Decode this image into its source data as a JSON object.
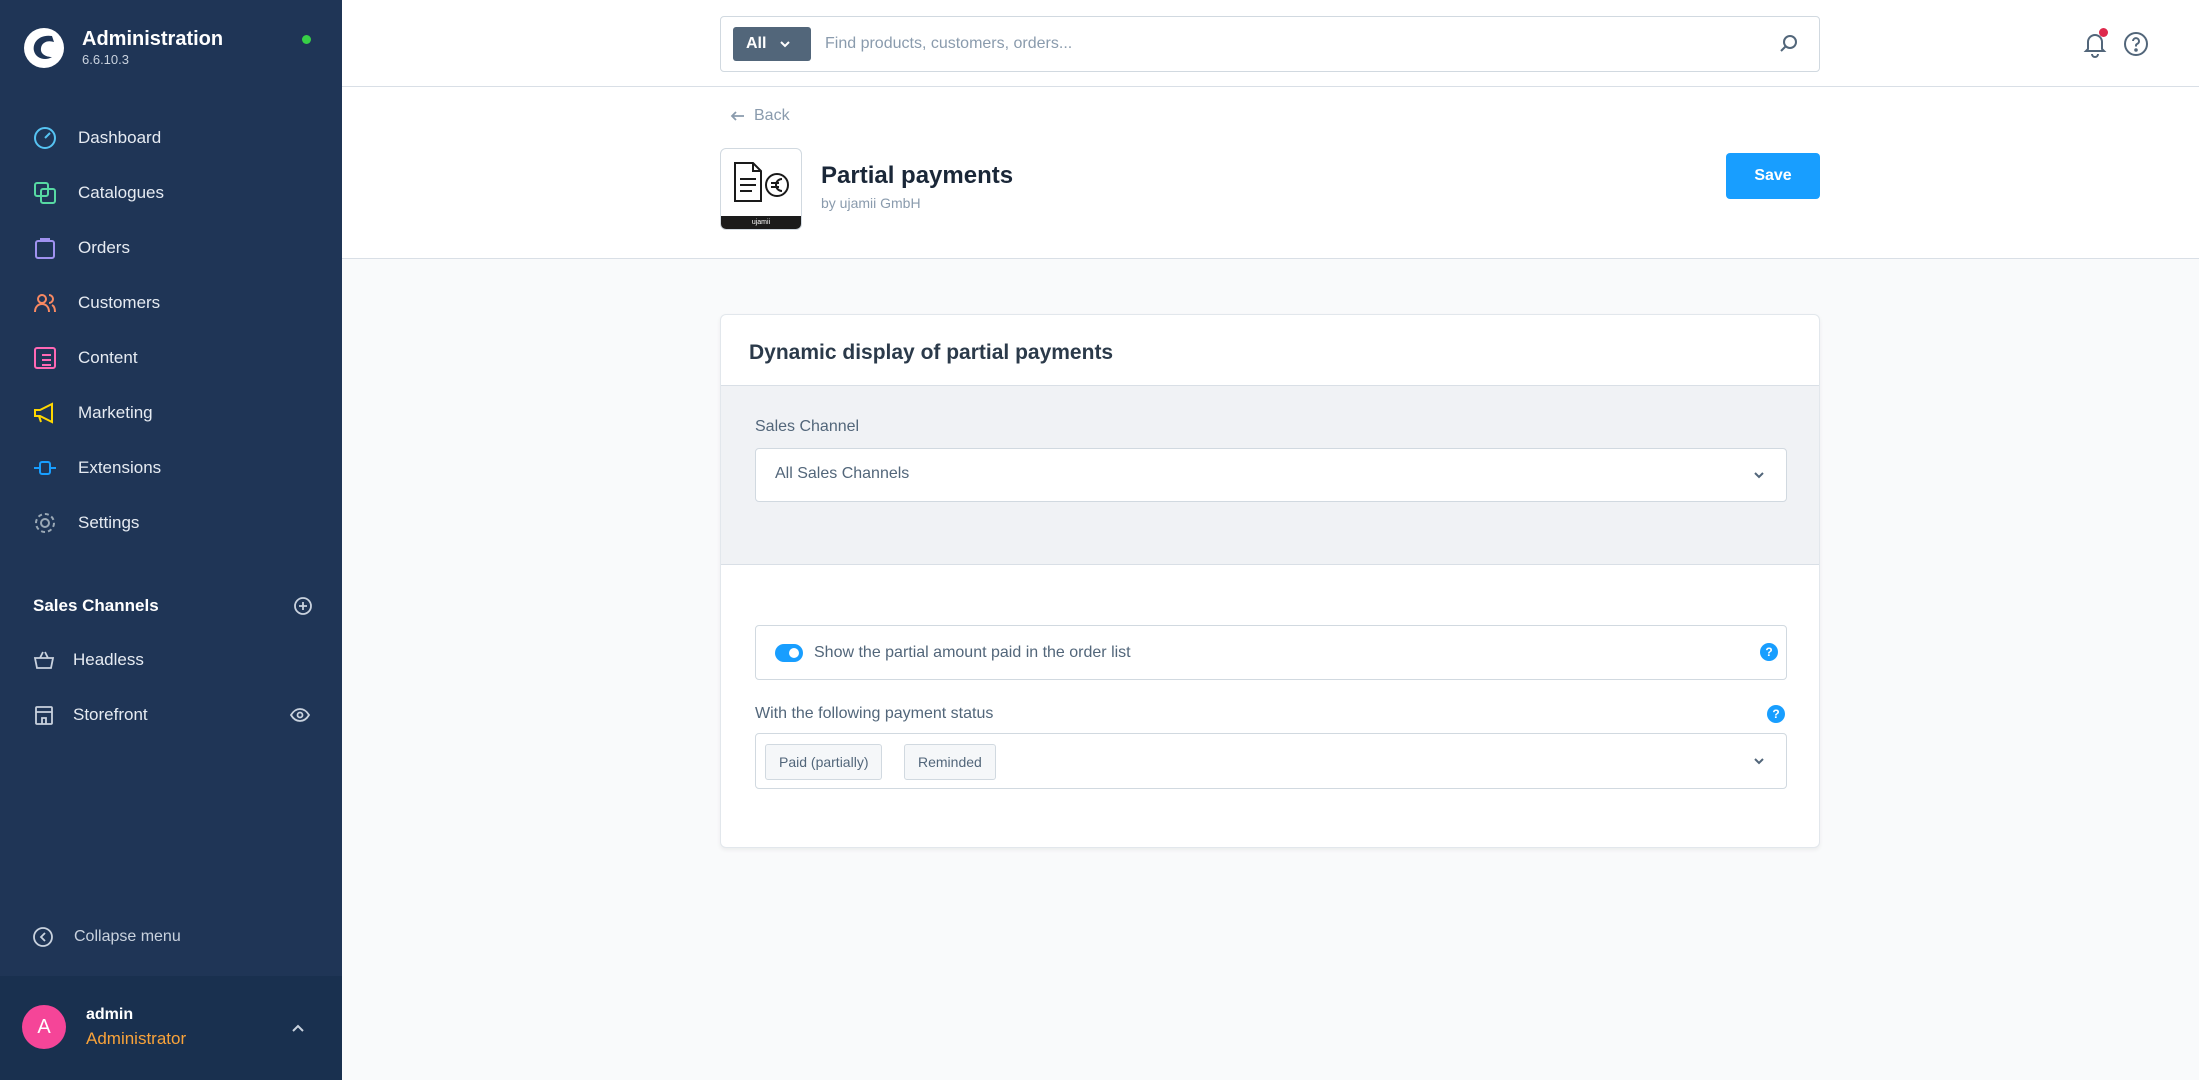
{
  "app": {
    "title": "Administration",
    "version": "6.6.10.3",
    "status_color": "#37d046"
  },
  "sidebar": {
    "items": [
      {
        "label": "Dashboard",
        "icon": "dashboard-icon",
        "color": "#56c3f2"
      },
      {
        "label": "Catalogues",
        "icon": "catalogues-icon",
        "color": "#57d9a3"
      },
      {
        "label": "Orders",
        "icon": "orders-icon",
        "color": "#a092f0"
      },
      {
        "label": "Customers",
        "icon": "customers-icon",
        "color": "#f88962"
      },
      {
        "label": "Content",
        "icon": "content-icon",
        "color": "#ff68b4"
      },
      {
        "label": "Marketing",
        "icon": "marketing-icon",
        "color": "#ffd700"
      },
      {
        "label": "Extensions",
        "icon": "extensions-icon",
        "color": "#189eff"
      },
      {
        "label": "Settings",
        "icon": "settings-icon",
        "color": "#9aa8b5"
      }
    ],
    "sales_channels_title": "Sales Channels",
    "sales_channels": [
      {
        "label": "Headless",
        "icon": "basket-icon"
      },
      {
        "label": "Storefront",
        "icon": "storefront-icon"
      }
    ],
    "collapse_label": "Collapse menu"
  },
  "user": {
    "initial": "A",
    "name": "admin",
    "role": "Administrator"
  },
  "search": {
    "type_label": "All",
    "placeholder": "Find products, customers, orders..."
  },
  "header": {
    "back_label": "Back",
    "plugin_title": "Partial payments",
    "plugin_author": "by ujamii GmbH",
    "plugin_brand": "ujamii",
    "save_label": "Save"
  },
  "card": {
    "title": "Dynamic display of partial payments",
    "sales_channel_label": "Sales Channel",
    "sales_channel_value": "All Sales Channels",
    "toggle_label": "Show the partial amount paid in the order list",
    "toggle_on": true,
    "payment_status_label": "With the following payment status",
    "payment_status_tags": [
      "Paid (partially)",
      "Reminded"
    ],
    "help_glyph": "?"
  },
  "colors": {
    "accent": "#189eff",
    "sidebar": "#1f3556",
    "role": "#f9a33a",
    "avatar": "#f54598"
  }
}
